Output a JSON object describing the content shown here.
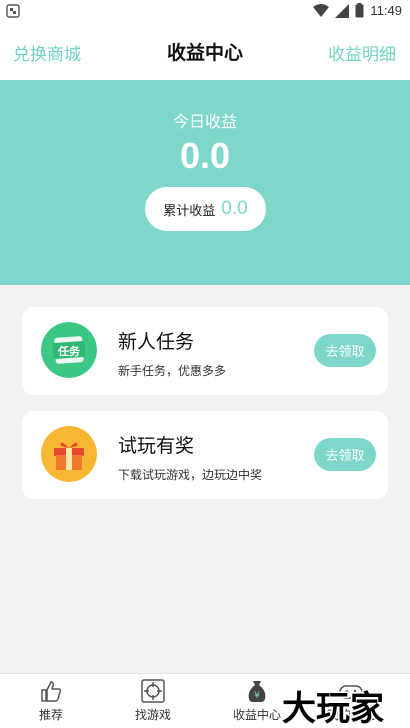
{
  "status": {
    "time": "11:49"
  },
  "nav": {
    "left": "兑换商城",
    "title": "收益中心",
    "right": "收益明细"
  },
  "hero": {
    "label": "今日收益",
    "value": "0.0",
    "total_label": "累计收益",
    "total_value": "0.0"
  },
  "cards": [
    {
      "title": "新人任务",
      "desc": "新手任务，优惠多多",
      "button": "去领取",
      "icon": "task-icon",
      "icon_text": "任务"
    },
    {
      "title": "试玩有奖",
      "desc": "下载试玩游戏，边玩边中奖",
      "button": "去领取",
      "icon": "gift-icon"
    }
  ],
  "tabs": [
    {
      "label": "推荐",
      "icon": "thumb-up-icon"
    },
    {
      "label": "找游戏",
      "icon": "crosshair-icon"
    },
    {
      "label": "收益中心",
      "icon": "money-bag-icon",
      "active": true
    },
    {
      "label": "我的游戏",
      "icon": "gamepad-icon"
    }
  ],
  "watermark": {
    "text": "大玩家"
  },
  "colors": {
    "accent": "#7fd7cc",
    "task_green": "#3dc784",
    "gift_orange": "#f5a623"
  }
}
